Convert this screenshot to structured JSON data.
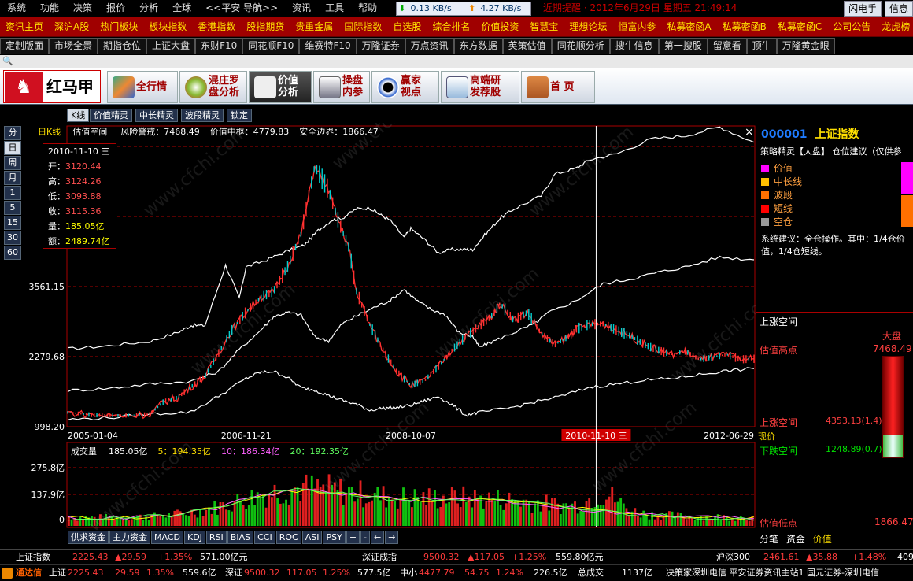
{
  "menu": {
    "items": [
      "系统",
      "功能",
      "决策",
      "报价",
      "分析",
      "全球",
      "<<平安 导航>>",
      "资讯",
      "工具",
      "帮助"
    ],
    "net_down": "0.13 KB/s",
    "net_up": "4.27 KB/s",
    "ticker": "近期提醒 · 2012年6月29日 星期五 21:49:14",
    "right_buttons": [
      "闪电手",
      "信息"
    ]
  },
  "redmenu": {
    "items": [
      "资讯主页",
      "深沪A股",
      "热门板块",
      "板块指数",
      "香港指数",
      "股指期货",
      "贵重金属",
      "国际指数",
      "自选股",
      "综合排名",
      "价值投资",
      "智慧宝",
      "理想论坛",
      "恒富内参",
      "私募密函A",
      "私募密函B",
      "私募密函C",
      "公司公告",
      "龙虎榜"
    ]
  },
  "tabs": {
    "items": [
      "定制版面",
      "市场全景",
      "期指仓位",
      "上证大盘",
      "东财F10",
      "同花顺F10",
      "维赛特F10",
      "万隆证券",
      "万点资讯",
      "东方数据",
      "英策估值",
      "同花顺分析",
      "搜牛信息",
      "第一搜股",
      "留意看",
      "顶牛",
      "万隆黄金眼"
    ]
  },
  "app": {
    "logo": "红马甲",
    "buttons": [
      {
        "label": "全行情"
      },
      {
        "label": "混庄罗盘分析"
      },
      {
        "label": "价值分析"
      },
      {
        "label": "操盘内参"
      },
      {
        "label": "赢家视点"
      },
      {
        "label": "高端研发荐股"
      },
      {
        "label": "首 页"
      }
    ]
  },
  "subtabs": [
    "K线",
    "价值精灵",
    "中长精灵",
    "波段精灵",
    "锁定"
  ],
  "periods": [
    "分",
    "日",
    "周",
    "月",
    "1",
    "5",
    "15",
    "30",
    "60"
  ],
  "chart_info": {
    "kind": "日K线",
    "name": "估值空间",
    "risk": "风险警戒：7468.49",
    "mid": "价值中枢：4779.83",
    "safe": "安全边界：1866.47",
    "close_icon": "×"
  },
  "tooltip": {
    "date": "2010-11-10 三",
    "rows": [
      {
        "k": "开：",
        "v": "3120.44"
      },
      {
        "k": "高：",
        "v": "3124.26"
      },
      {
        "k": "低：",
        "v": "3093.88"
      },
      {
        "k": "收：",
        "v": "3115.36"
      },
      {
        "k": "量：",
        "v": "185.05亿"
      },
      {
        "k": "额：",
        "v": "2489.74亿"
      }
    ]
  },
  "volume": {
    "label": "成交量",
    "value": "185.05亿",
    "ma5": "5：194.35亿",
    "ma10": "10：186.34亿",
    "ma20": "20：192.35亿",
    "yticks": [
      "275.8亿",
      "137.9亿",
      "0"
    ]
  },
  "indicators": [
    "供求资金",
    "主力资金",
    "MACD",
    "KDJ",
    "RSI",
    "BIAS",
    "CCI",
    "ROC",
    "ASI",
    "PSY",
    "+",
    "-",
    "←",
    "→"
  ],
  "chart_data": {
    "type": "line",
    "title": "",
    "x": [
      "2005-01-04",
      "2006-11-21",
      "2008-10-07",
      "2010-11-10 三",
      "2012-06-29"
    ],
    "yticks": [
      998.2,
      2279.68,
      3561.15,
      4842.63,
      6124.1
    ],
    "ytick_labels": [
      "998.20",
      "2279.68",
      "3561.15",
      "484",
      "612"
    ],
    "ylim": [
      998.2,
      6124.1
    ],
    "cursor_date": "2010-11-10 三",
    "series": [
      {
        "name": "",
        "color": "#ffffff",
        "values": [
          [
            0,
            2420
          ],
          [
            0.06,
            2480
          ],
          [
            0.12,
            2560
          ],
          [
            0.16,
            2720
          ],
          [
            0.18,
            2850
          ],
          [
            0.2,
            2850
          ],
          [
            0.23,
            3950
          ],
          [
            0.25,
            3350
          ],
          [
            0.26,
            3920
          ],
          [
            0.29,
            4050
          ],
          [
            0.32,
            4210
          ],
          [
            0.345,
            4320
          ],
          [
            0.365,
            4590
          ],
          [
            0.385,
            4780
          ],
          [
            0.4,
            4810
          ],
          [
            0.42,
            4980
          ],
          [
            0.44,
            5000
          ],
          [
            0.455,
            4880
          ],
          [
            0.47,
            4770
          ],
          [
            0.49,
            4460
          ],
          [
            0.5,
            4620
          ],
          [
            0.52,
            4420
          ],
          [
            0.54,
            4180
          ],
          [
            0.56,
            4240
          ],
          [
            0.58,
            4240
          ],
          [
            0.59,
            4240
          ],
          [
            0.61,
            4540
          ],
          [
            0.63,
            4810
          ],
          [
            0.65,
            4980
          ],
          [
            0.69,
            5220
          ],
          [
            0.71,
            5620
          ],
          [
            0.74,
            5720
          ],
          [
            0.76,
            5880
          ],
          [
            0.8,
            5990
          ],
          [
            0.85,
            6260
          ],
          [
            0.9,
            6320
          ],
          [
            0.95,
            6480
          ],
          [
            1.0,
            6200
          ]
        ]
      },
      {
        "name": "",
        "color": "#ffffff",
        "values": [
          [
            0,
            1660
          ],
          [
            0.06,
            1700
          ],
          [
            0.12,
            1780
          ],
          [
            0.18,
            1830
          ],
          [
            0.22,
            2010
          ],
          [
            0.25,
            2410
          ],
          [
            0.28,
            2750
          ],
          [
            0.3,
            3010
          ],
          [
            0.32,
            3090
          ],
          [
            0.34,
            3040
          ],
          [
            0.36,
            2640
          ],
          [
            0.38,
            2570
          ],
          [
            0.4,
            2880
          ],
          [
            0.42,
            3020
          ],
          [
            0.45,
            3200
          ],
          [
            0.47,
            3310
          ],
          [
            0.49,
            3510
          ],
          [
            0.51,
            3290
          ],
          [
            0.53,
            3140
          ],
          [
            0.55,
            3050
          ],
          [
            0.57,
            2720
          ],
          [
            0.59,
            2650
          ],
          [
            0.6,
            2450
          ],
          [
            0.62,
            2560
          ],
          [
            0.65,
            2720
          ],
          [
            0.68,
            2880
          ],
          [
            0.7,
            3080
          ],
          [
            0.74,
            3300
          ],
          [
            0.78,
            3610
          ],
          [
            0.82,
            3700
          ],
          [
            0.86,
            3820
          ],
          [
            0.9,
            3920
          ],
          [
            0.95,
            4100
          ],
          [
            1.0,
            4050
          ]
        ]
      },
      {
        "name": "",
        "color": "#ffffff",
        "values": [
          [
            0,
            1130
          ],
          [
            0.06,
            1160
          ],
          [
            0.12,
            1230
          ],
          [
            0.18,
            1270
          ],
          [
            0.22,
            1560
          ],
          [
            0.26,
            1880
          ],
          [
            0.28,
            1990
          ],
          [
            0.3,
            2010
          ],
          [
            0.32,
            1900
          ],
          [
            0.34,
            1710
          ],
          [
            0.36,
            1670
          ],
          [
            0.38,
            1570
          ],
          [
            0.4,
            1480
          ],
          [
            0.42,
            1410
          ],
          [
            0.44,
            1300
          ],
          [
            0.46,
            1340
          ],
          [
            0.48,
            1350
          ],
          [
            0.5,
            1390
          ],
          [
            0.52,
            1470
          ],
          [
            0.54,
            1550
          ],
          [
            0.56,
            1400
          ],
          [
            0.58,
            1210
          ],
          [
            0.6,
            1260
          ],
          [
            0.64,
            1330
          ],
          [
            0.68,
            1450
          ],
          [
            0.72,
            1560
          ],
          [
            0.76,
            1720
          ],
          [
            0.8,
            1780
          ],
          [
            0.84,
            1850
          ],
          [
            0.88,
            1880
          ],
          [
            0.92,
            1950
          ],
          [
            0.96,
            2020
          ],
          [
            1.0,
            2060
          ]
        ]
      },
      {
        "name": "",
        "color": "#ff3030",
        "values": [
          [
            0,
            1260
          ],
          [
            0.04,
            1210
          ],
          [
            0.08,
            1200
          ],
          [
            0.12,
            1230
          ],
          [
            0.14,
            1460
          ],
          [
            0.16,
            1530
          ],
          [
            0.18,
            1730
          ],
          [
            0.2,
            1920
          ],
          [
            0.22,
            2350
          ],
          [
            0.24,
            2780
          ],
          [
            0.26,
            3100
          ],
          [
            0.28,
            3350
          ],
          [
            0.3,
            3480
          ],
          [
            0.32,
            3920
          ],
          [
            0.34,
            4520
          ],
          [
            0.36,
            5760
          ],
          [
            0.38,
            5330
          ],
          [
            0.395,
            4740
          ],
          [
            0.41,
            4260
          ],
          [
            0.42,
            3500
          ],
          [
            0.44,
            2870
          ],
          [
            0.46,
            2380
          ],
          [
            0.48,
            2000
          ],
          [
            0.5,
            1760
          ],
          [
            0.52,
            1840
          ],
          [
            0.54,
            2100
          ],
          [
            0.56,
            2400
          ],
          [
            0.58,
            2640
          ],
          [
            0.6,
            2850
          ],
          [
            0.62,
            3050
          ],
          [
            0.63,
            3250
          ],
          [
            0.65,
            2950
          ],
          [
            0.67,
            3090
          ],
          [
            0.69,
            2700
          ],
          [
            0.71,
            2500
          ],
          [
            0.73,
            2650
          ],
          [
            0.74,
            2780
          ],
          [
            0.76,
            2870
          ],
          [
            0.78,
            2880
          ],
          [
            0.8,
            2760
          ],
          [
            0.82,
            2660
          ],
          [
            0.84,
            2500
          ],
          [
            0.86,
            2400
          ],
          [
            0.88,
            2320
          ],
          [
            0.9,
            2380
          ],
          [
            0.92,
            2230
          ],
          [
            0.94,
            2270
          ],
          [
            0.96,
            2320
          ],
          [
            0.98,
            2230
          ],
          [
            1.0,
            2240
          ]
        ]
      }
    ],
    "volume": {
      "ylim": [
        0,
        300
      ],
      "count": 240
    }
  },
  "rightpanel": {
    "code": "000001",
    "name": "上证指数",
    "subtitle": "策略精灵【大盘】 仓位建议（仅供参",
    "legend": [
      {
        "label": "价值",
        "color": "#ff00ff"
      },
      {
        "label": "中长线",
        "color": "#ffc000"
      },
      {
        "label": "波段",
        "color": "#ff7000"
      },
      {
        "label": "短线",
        "color": "#ff0000"
      },
      {
        "label": "空仓",
        "color": "#999999"
      }
    ],
    "advice": "系统建议：全仓操作。其中：1/4仓价值，1/4仓短线。",
    "space_title": "上涨空间",
    "big_label": "大盘",
    "high_label": "估值高点",
    "high_value": "7468.49",
    "up_label": "上涨空间",
    "up_value": "4353.13(1.4)",
    "down_label": "下跌空间",
    "down_value": "1248.89(0.7)",
    "low_label": "估值低点",
    "low_value": "1866.47",
    "current_label": "现价",
    "up_fraction": 0.78,
    "down_fraction": 0.22,
    "buttons": [
      "分笔",
      "资金",
      "价值"
    ]
  },
  "bottom1": {
    "name": "上证指数",
    "price": "2225.43",
    "chg": "▲29.59",
    "pct": "+1.35%",
    "amount": "571.00亿元",
    "name2": "深证成指",
    "price2": "9500.32",
    "chg2": "▲117.05",
    "pct2": "+1.25%",
    "amount2": "559.80亿元",
    "name3": "沪深300",
    "price3": "2461.61",
    "chg3": "▲35.88",
    "pct3": "+1.48%",
    "amount3": "409"
  },
  "bottom2": {
    "brand": "通达信",
    "a_name": "上证",
    "a_price": "2225.43",
    "a_chg": "29.59",
    "a_pct": "1.35%",
    "a_amt": "559.6亿",
    "b_name": "深证",
    "b_price": "9500.32",
    "b_chg": "117.05",
    "b_pct": "1.25%",
    "b_amt": "577.5亿",
    "c_name": "中小",
    "c_price": "4477.79",
    "c_chg": "54.75",
    "c_pct": "1.24%",
    "c_amt": "226.5亿",
    "total_label": "总成交",
    "total": "1137亿",
    "info": "决策家深圳电信  平安证券资讯主站1  国元证券-深圳电信"
  },
  "watermark": "www.cfchi.com"
}
